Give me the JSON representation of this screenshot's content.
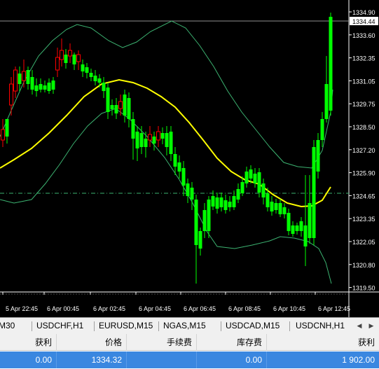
{
  "chart": {
    "price_axis": [
      "1334.90",
      "1333.60",
      "1332.35",
      "1331.05",
      "1329.75",
      "1328.50",
      "1327.20",
      "1325.90",
      "1324.65",
      "1323.35",
      "1322.05",
      "1320.80",
      "1319.50"
    ],
    "current_price": "1334.44",
    "time_axis": [
      "5 Apr 22:45",
      "6 Apr 00:45",
      "6 Apr 02:45",
      "6 Apr 04:45",
      "6 Apr 06:45",
      "6 Apr 08:45",
      "6 Apr 10:45",
      "6 Apr 12:45"
    ],
    "colors": {
      "bull": "#ff0000",
      "bear": "#00ff00",
      "ma": "#ffff00",
      "bands": "#3cb371",
      "axis": "#ffffff"
    }
  },
  "tabs": [
    "M30",
    "USDCHF,H1",
    "EURUSD,M15",
    "NGAS,M15",
    "USDCAD,M15",
    "USDCNH,H1"
  ],
  "table": {
    "headers": [
      "获利",
      "价格",
      "手续费",
      "库存费",
      "获利"
    ],
    "row": [
      "0.00",
      "1334.32",
      "",
      "0.00",
      "1 902.00"
    ]
  }
}
